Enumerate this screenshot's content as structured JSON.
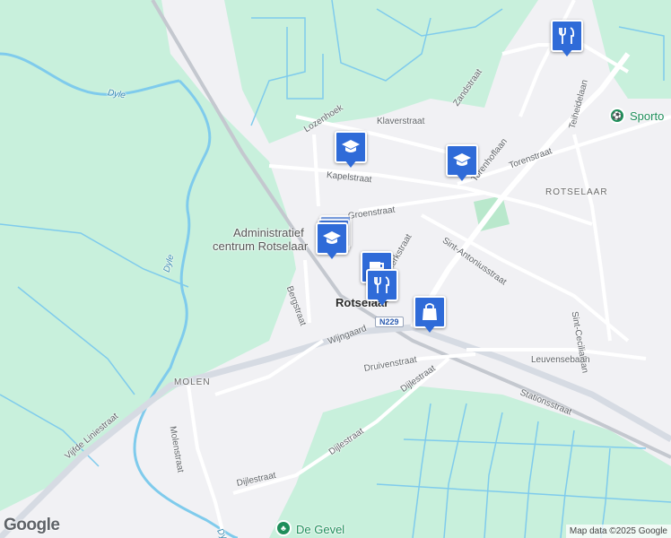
{
  "map": {
    "labels": {
      "dyle_1": "Dyle",
      "dyle_2": "Dyle",
      "dyle_3": "Dyle",
      "lozenhoek": "Lozenhoek",
      "klaverstraat": "Klaverstraat",
      "zandstraat": "Zandstraat",
      "kapelstraat": "Kapelstraat",
      "torenstraat": "Torenstraat",
      "torenhoflaan": "Torenhoflaan",
      "teiheidelaan": "Teiheidelaan",
      "rotselaar_district": "ROTSELAAR",
      "groenstraat": "Groenstraat",
      "admin_line1": "Administratief",
      "admin_line2": "centrum Rotselaar",
      "sint_antonius": "Sint-Antoniusstraat",
      "sint_cecilia": "Sint-Cecilialaan",
      "bergstraat": "Bergstraat",
      "wijngaard": "Wijngaard",
      "kerkstraat": "Kerkstraat",
      "rotselaar": "Rotselaar",
      "leuvensebaan": "Leuvensebaan",
      "molen": "MOLEN",
      "druivenstraat": "Druivenstraat",
      "dijlestraat_1": "Dijlestraat",
      "dijlestraat_2": "Dijlestraat",
      "dijlestraat_3": "Dijlestraat",
      "stationsstraat": "Stationsstraat",
      "vijfde_liniestraat": "Vijfde Liniestraat",
      "molenstraat": "Molenstraat",
      "sport": "Sporto",
      "de_gevel": "De Gevel",
      "route": "N229"
    },
    "markers": [
      {
        "icon": "restaurant-icon",
        "name": "restaurant-marker-north"
      },
      {
        "icon": "school-icon",
        "name": "school-marker-kapelstraat"
      },
      {
        "icon": "school-icon",
        "name": "school-marker-torenstraat"
      },
      {
        "icon": "school-icon",
        "name": "school-marker-admin"
      },
      {
        "icon": "cafe-icon",
        "name": "cafe-marker-center"
      },
      {
        "icon": "restaurant-icon",
        "name": "restaurant-marker-center"
      },
      {
        "icon": "shopping-bag-icon",
        "name": "shop-marker-center"
      }
    ],
    "colors": {
      "land": "#f1f1f4",
      "green": "#c8f0dc",
      "water": "#7fcbec",
      "road": "#ffffff",
      "major_road": "#d6dbe3",
      "marker": "#2f6bd8"
    },
    "attribution": "Map data ©2025 Google",
    "logo": "Google"
  }
}
